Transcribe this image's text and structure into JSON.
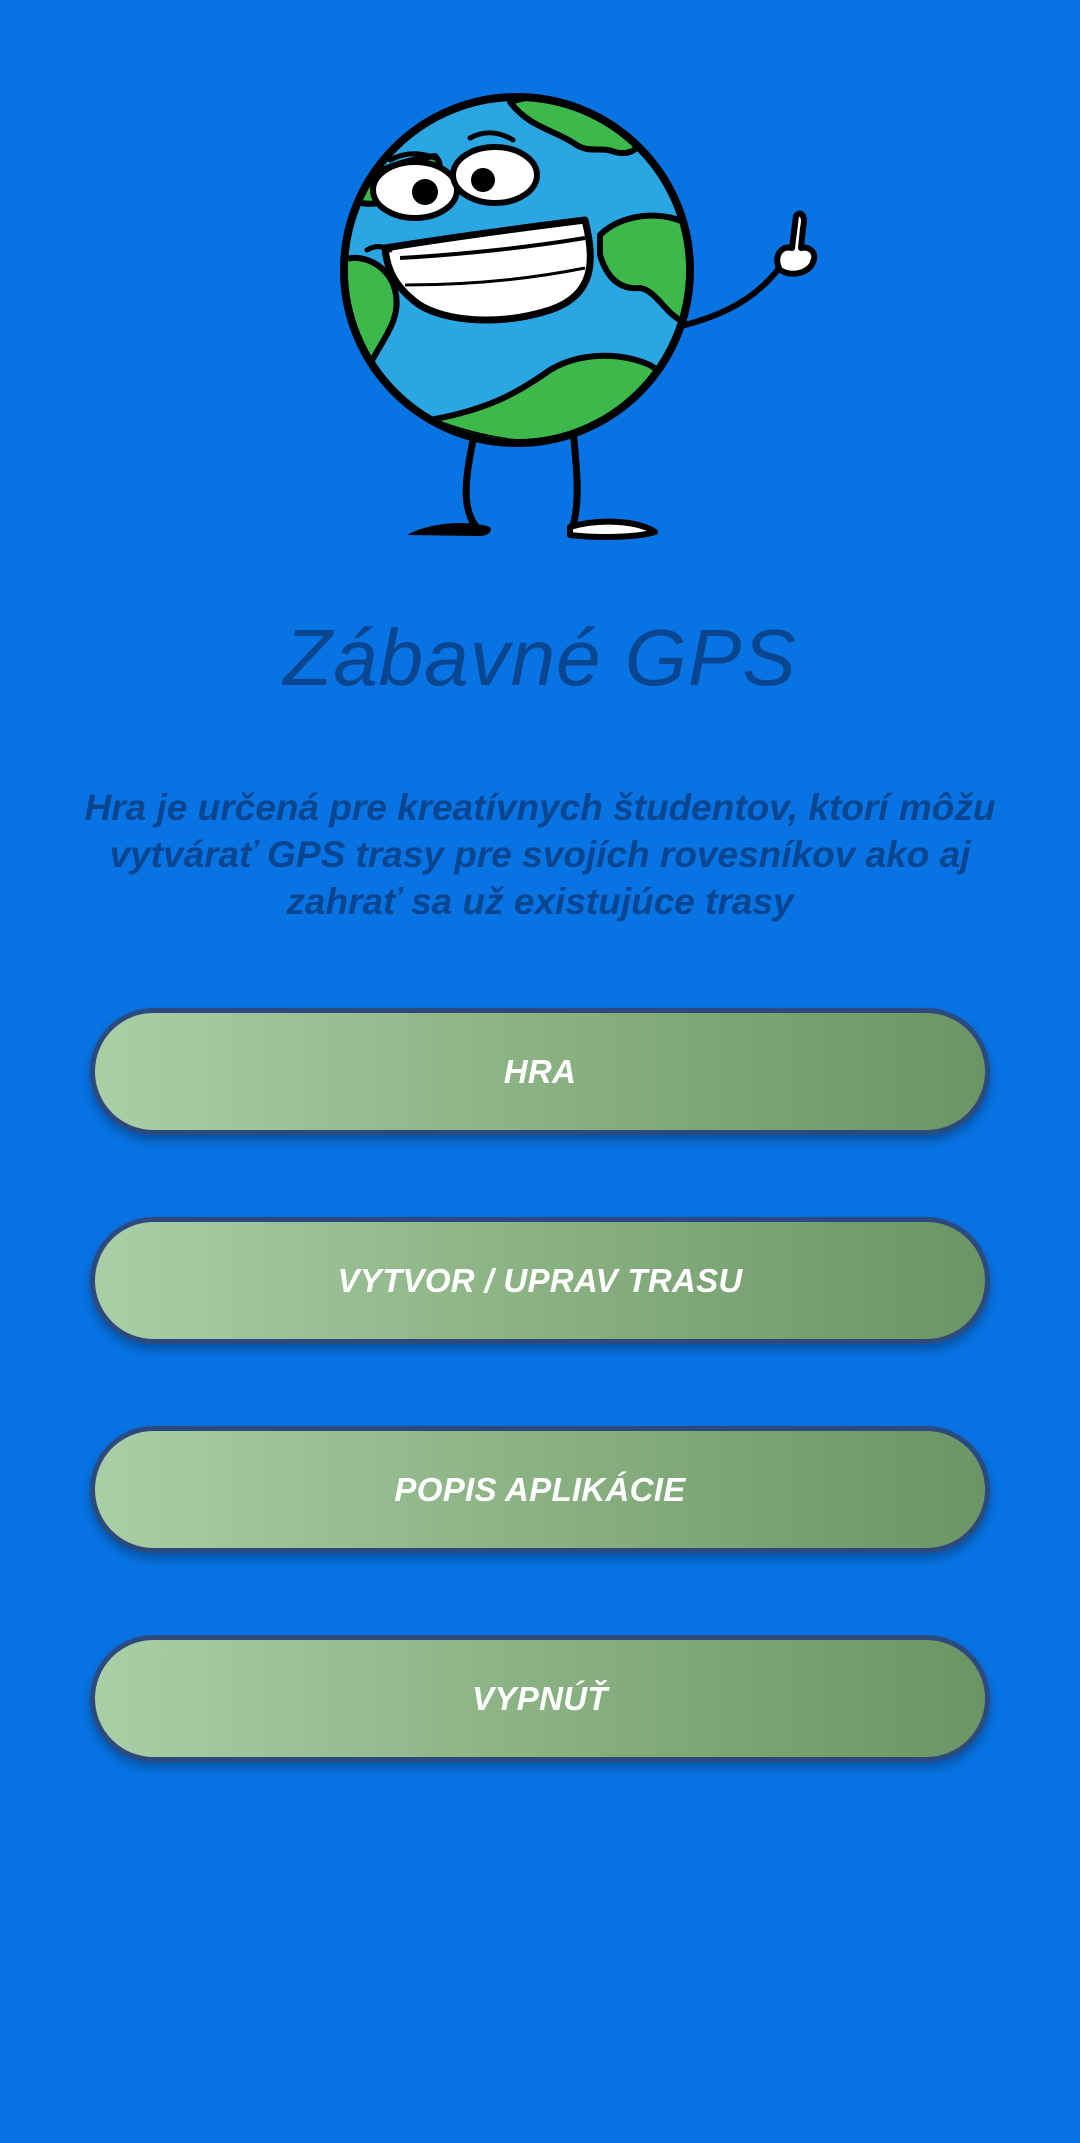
{
  "app": {
    "title": "Zábavné GPS",
    "description": "Hra je určená pre kreatívnych študentov, ktorí môžu vytvárať GPS trasy pre svojích rovesníkov ako aj zahrať sa už existujúce trasy"
  },
  "menu": {
    "play_label": "HRA",
    "create_label": "VYTVOR / UPRAV TRASU",
    "about_label": "POPIS APLIKÁCIE",
    "exit_label": "VYPNÚŤ"
  },
  "mascot": {
    "icon": "smiling-earth-mascot-icon"
  },
  "colors": {
    "background": "#0873e3",
    "text": "#0a4590",
    "button_gradient_start": "#a9cfa7",
    "button_gradient_end": "#6a9565",
    "button_border": "#2c4a7e",
    "earth_ocean": "#2aa6e2",
    "earth_land": "#3db84b"
  }
}
